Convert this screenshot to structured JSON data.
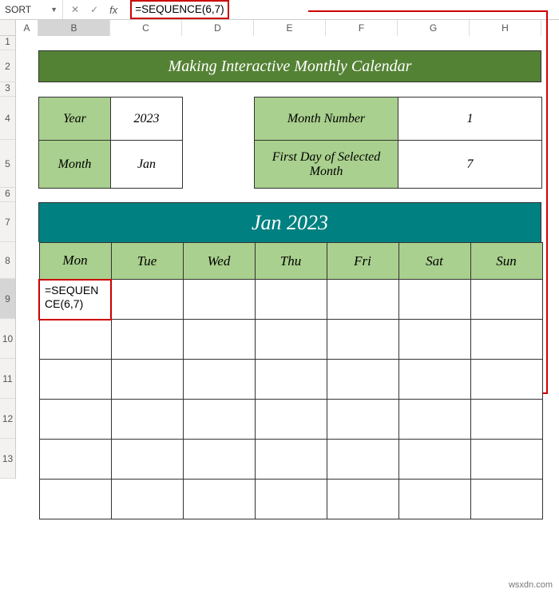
{
  "namebox": "SORT",
  "formula": "=SEQUENCE(6,7)",
  "fx_label": "fx",
  "columns": [
    "A",
    "B",
    "C",
    "D",
    "E",
    "F",
    "G",
    "H"
  ],
  "rows": [
    "1",
    "2",
    "3",
    "4",
    "5",
    "6",
    "7",
    "8",
    "9",
    "10",
    "11",
    "12",
    "13"
  ],
  "title": "Making Interactive Monthly Calendar",
  "info": {
    "year_label": "Year",
    "year_value": "2023",
    "month_label": "Month",
    "month_value": "Jan",
    "monthnum_label": "Month Number",
    "monthnum_value": "1",
    "firstday_label": "First Day of Selected Month",
    "firstday_value": "7"
  },
  "calendar": {
    "header": "Jan 2023",
    "days": [
      "Mon",
      "Tue",
      "Wed",
      "Thu",
      "Fri",
      "Sat",
      "Sun"
    ],
    "edit_text": "=SEQUENCE(6,7)"
  },
  "watermark": "wsxdn.com",
  "chart_data": {
    "type": "table",
    "title": "Making Interactive Monthly Calendar",
    "info_pairs": [
      {
        "label": "Year",
        "value": 2023
      },
      {
        "label": "Month",
        "value": "Jan"
      },
      {
        "label": "Month Number",
        "value": 1
      },
      {
        "label": "First Day of Selected Month",
        "value": 7
      }
    ],
    "calendar_header": "Jan 2023",
    "day_headers": [
      "Mon",
      "Tue",
      "Wed",
      "Thu",
      "Fri",
      "Sat",
      "Sun"
    ],
    "active_formula": "=SEQUENCE(6,7)",
    "active_cell": "B9"
  }
}
